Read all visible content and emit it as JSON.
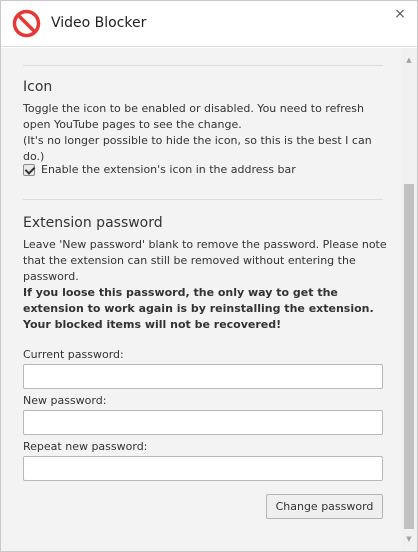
{
  "header": {
    "title": "Video Blocker",
    "close_label": "×",
    "logo_icon": "no-entry-icon",
    "logo_color": "#e53935"
  },
  "icon_section": {
    "title": "Icon",
    "description": "Toggle the icon to be enabled or disabled. You need to refresh open YouTube pages to see the change.",
    "note": "(It's no longer possible to hide the icon, so this is the best I can do.)",
    "checkbox_label": "Enable the extension's icon in the address bar",
    "checkbox_checked": true
  },
  "password_section": {
    "title": "Extension password",
    "description": "Leave 'New password' blank to remove the password. Please note that the extension can still be removed without entering the password.",
    "warning": "If you loose this password, the only way to get the extension to work again is by reinstalling the extension. Your blocked items will not be recovered!",
    "current_label": "Current password:",
    "current_value": "",
    "new_label": "New password:",
    "new_value": "",
    "repeat_label": "Repeat new password:",
    "repeat_value": "",
    "submit_label": "Change password"
  },
  "scrollbar": {
    "up_icon": "scroll-up-arrow-icon",
    "down_icon": "scroll-down-arrow-icon"
  }
}
